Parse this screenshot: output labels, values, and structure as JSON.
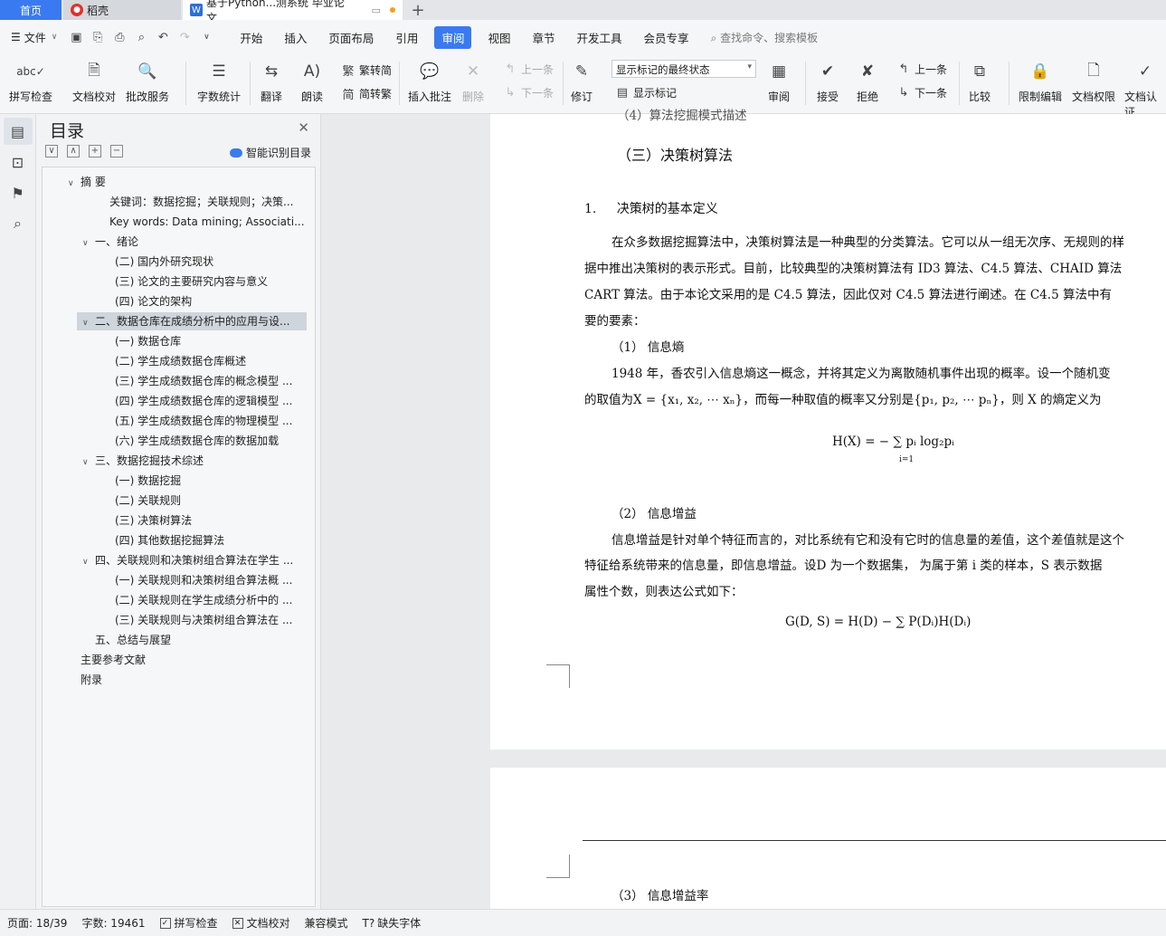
{
  "tabs": {
    "home": "首页",
    "daoke": "稻壳",
    "doc": "基于Python...测系统 毕业论文",
    "new": "+"
  },
  "menu": {
    "file": "文件",
    "items": [
      "开始",
      "插入",
      "页面布局",
      "引用",
      "审阅",
      "视图",
      "章节",
      "开发工具",
      "会员专享"
    ],
    "active": "审阅",
    "search": "查找命令、搜索模板"
  },
  "ribbon": {
    "spellcheck": "拼写检查",
    "doc_proof": "文档校对",
    "revise_service": "批改服务",
    "word_count": "字数统计",
    "translate": "翻译",
    "read_aloud": "朗读",
    "trad_to_simp": "繁转简",
    "simp_to_trad": "简转繁",
    "insert_comment": "插入批注",
    "delete": "删除",
    "prev": "上一条",
    "next": "下一条",
    "revise": "修订",
    "markup_state": "显示标记的最终状态",
    "show_markup": "显示标记",
    "review": "审阅",
    "accept": "接受",
    "reject": "拒绝",
    "prev2": "上一条",
    "next2": "下一条",
    "compare": "比较",
    "restrict_edit": "限制编辑",
    "doc_permission": "文档权限",
    "doc_cert": "文档认证"
  },
  "nav": {
    "title": "目录",
    "smart": "智能识别目录",
    "toc": [
      {
        "text": "摘 要",
        "caret": "∨"
      },
      {
        "text": "关键词：数据挖掘；关联规则；决策..."
      },
      {
        "text": "Key words: Data mining; Associati..."
      },
      {
        "text": "一、绪论",
        "caret": "∨"
      },
      {
        "text": "(二) 国内外研究现状"
      },
      {
        "text": "(三) 论文的主要研究内容与意义"
      },
      {
        "text": "(四) 论文的架构"
      },
      {
        "text": "二、数据仓库在成绩分析中的应用与设...",
        "caret": "∨"
      },
      {
        "text": "(一) 数据仓库"
      },
      {
        "text": "(二) 学生成绩数据仓库概述"
      },
      {
        "text": "(三) 学生成绩数据仓库的概念模型 ..."
      },
      {
        "text": "(四) 学生成绩数据仓库的逻辑模型 ..."
      },
      {
        "text": "(五) 学生成绩数据仓库的物理模型 ..."
      },
      {
        "text": "(六) 学生成绩数据仓库的数据加载"
      },
      {
        "text": "三、数据挖掘技术综述",
        "caret": "∨"
      },
      {
        "text": "(一) 数据挖掘"
      },
      {
        "text": "(二) 关联规则"
      },
      {
        "text": "(三) 决策树算法"
      },
      {
        "text": "(四) 其他数据挖掘算法"
      },
      {
        "text": "四、关联规则和决策树组合算法在学生 ...",
        "caret": "∨"
      },
      {
        "text": "(一) 关联规则和决策树组合算法概 ..."
      },
      {
        "text": "(二) 关联规则在学生成绩分析中的 ..."
      },
      {
        "text": "(三) 关联规则与决策树组合算法在 ..."
      },
      {
        "text": "五、总结与展望"
      },
      {
        "text": "主要参考文献"
      },
      {
        "text": "附录"
      }
    ]
  },
  "doc": {
    "top_cut": "（4）算法挖掘模式描述",
    "heading3": "（三）决策树算法",
    "heading_num": "1.",
    "heading_text": "决策树的基本定义",
    "p1_l1": "在众多数据挖掘算法中，决策树算法是一种典型的分类算法。它可以从一组无次序、无规则的样",
    "p1_l2": "据中推出决策树的表示形式。目前，比较典型的决策树算法有 ID3 算法、C4.5 算法、CHAID 算法",
    "p1_l3": "CART 算法。由于本论文采用的是 C4.5 算法，因此仅对 C4.5 算法进行阐述。在 C4.5 算法中有",
    "p1_l4": "要的要素：",
    "sub1": "（1） 信息熵",
    "p2_l1": "1948 年，香农引入信息熵这一概念，并将其定义为离散随机事件出现的概率。设一个随机变",
    "p2_l2": "的取值为X = {x₁, x₂, ⋯ xₙ}，而每一种取值的概率又分别是{p₁, p₂, ⋯ pₙ}，则 X 的熵定义为",
    "formula1": "H(X) = − ∑ pᵢ log₂pᵢ",
    "formula1_sub": "i=1",
    "sub2": "（2） 信息增益",
    "p3_l1": "信息增益是针对单个特征而言的，对比系统有它和没有它时的信息量的差值，这个差值就是这个",
    "p3_l2": "特征给系统带来的信息量，即信息增益。设D 为一个数据集，  为属于第 i 类的样本，S 表示数据",
    "p3_l3": "属性个数，则表达公式如下：",
    "formula2": "G(D, S) = H(D) − ∑ P(Dᵢ)H(Dᵢ)",
    "sub3": "（3） 信息增益率"
  },
  "status": {
    "page": "页面: 18/39",
    "words": "字数: 19461",
    "spell": "拼写检查",
    "proof": "文档校对",
    "compat": "兼容模式",
    "font": "缺失字体"
  }
}
